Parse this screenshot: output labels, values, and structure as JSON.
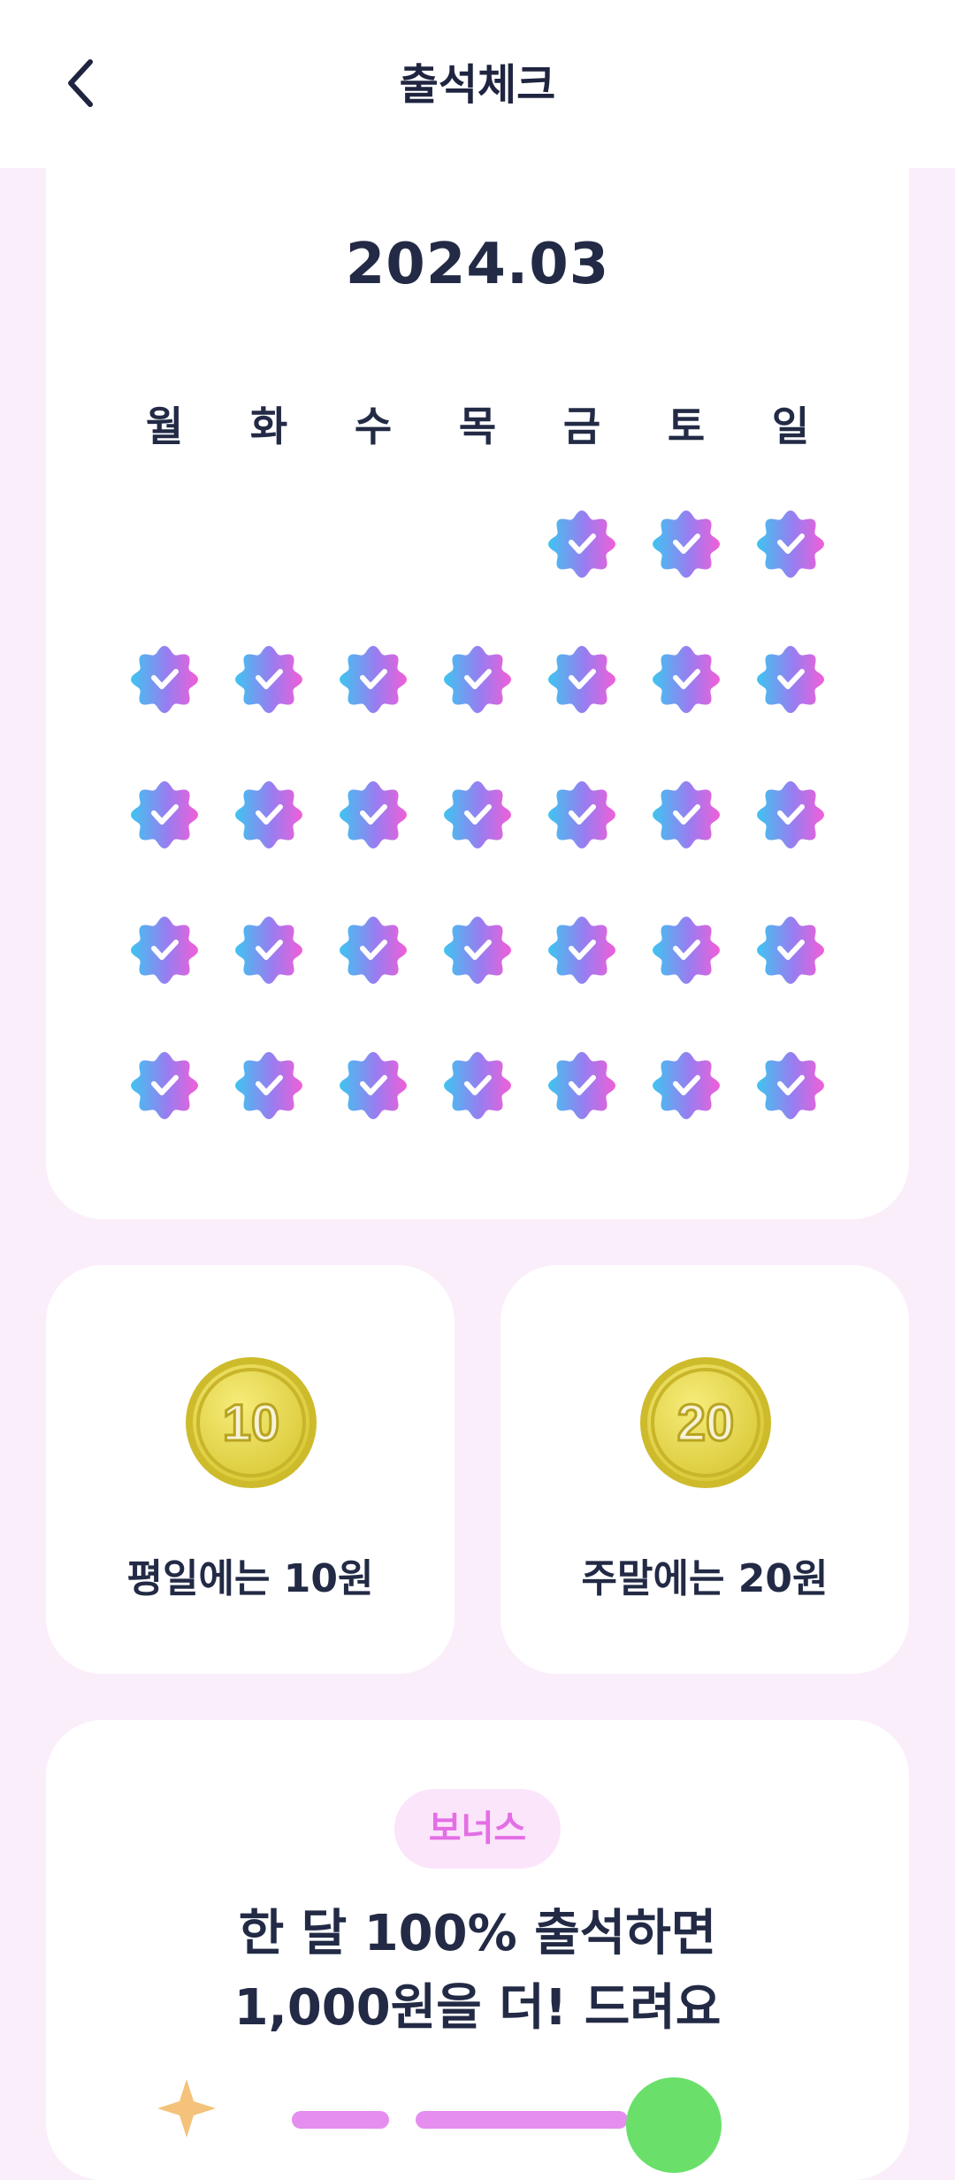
{
  "header": {
    "title": "출석체크",
    "back_icon": "chevron-left-icon"
  },
  "calendar": {
    "month": "2024.03",
    "weekdays": [
      "월",
      "화",
      "수",
      "목",
      "금",
      "토",
      "일"
    ],
    "stamp_icon": "check-badge-icon",
    "stamp_colors": [
      "#3fc4f0",
      "#f05fd8"
    ],
    "first_day_column": 4,
    "checked_days": 31
  },
  "rewards": {
    "weekday": {
      "coin": "10",
      "label": "평일에는 10원"
    },
    "weekend": {
      "coin": "20",
      "label": "주말에는 20원"
    },
    "coin_color": "#e6d84a"
  },
  "bonus": {
    "badge": "보너스",
    "line1": "한 달 100% 출석하면",
    "line2": "1,000원을 더! 드려요"
  },
  "colors": {
    "background": "#fbeefb",
    "text": "#222a45",
    "accent_pink": "#e46ee5"
  }
}
